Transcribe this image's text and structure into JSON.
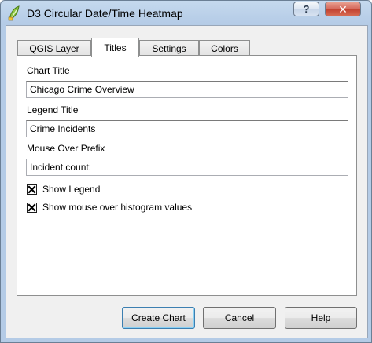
{
  "window": {
    "title": "D3 Circular Date/Time Heatmap",
    "help_glyph": "?",
    "close_glyph": "✕"
  },
  "tabs": [
    {
      "label": "QGIS Layer"
    },
    {
      "label": "Titles"
    },
    {
      "label": "Settings"
    },
    {
      "label": "Colors"
    }
  ],
  "active_tab": "Titles",
  "form": {
    "chart_title_label": "Chart Title",
    "chart_title_value": "Chicago Crime Overview",
    "legend_title_label": "Legend Title",
    "legend_title_value": "Crime Incidents",
    "mouse_over_label": "Mouse Over Prefix",
    "mouse_over_value": "Incident count:",
    "show_legend_label": "Show Legend",
    "show_legend_checked": true,
    "show_histogram_label": "Show mouse over histogram values",
    "show_histogram_checked": true
  },
  "buttons": {
    "create_chart": "Create Chart",
    "cancel": "Cancel",
    "help": "Help"
  }
}
